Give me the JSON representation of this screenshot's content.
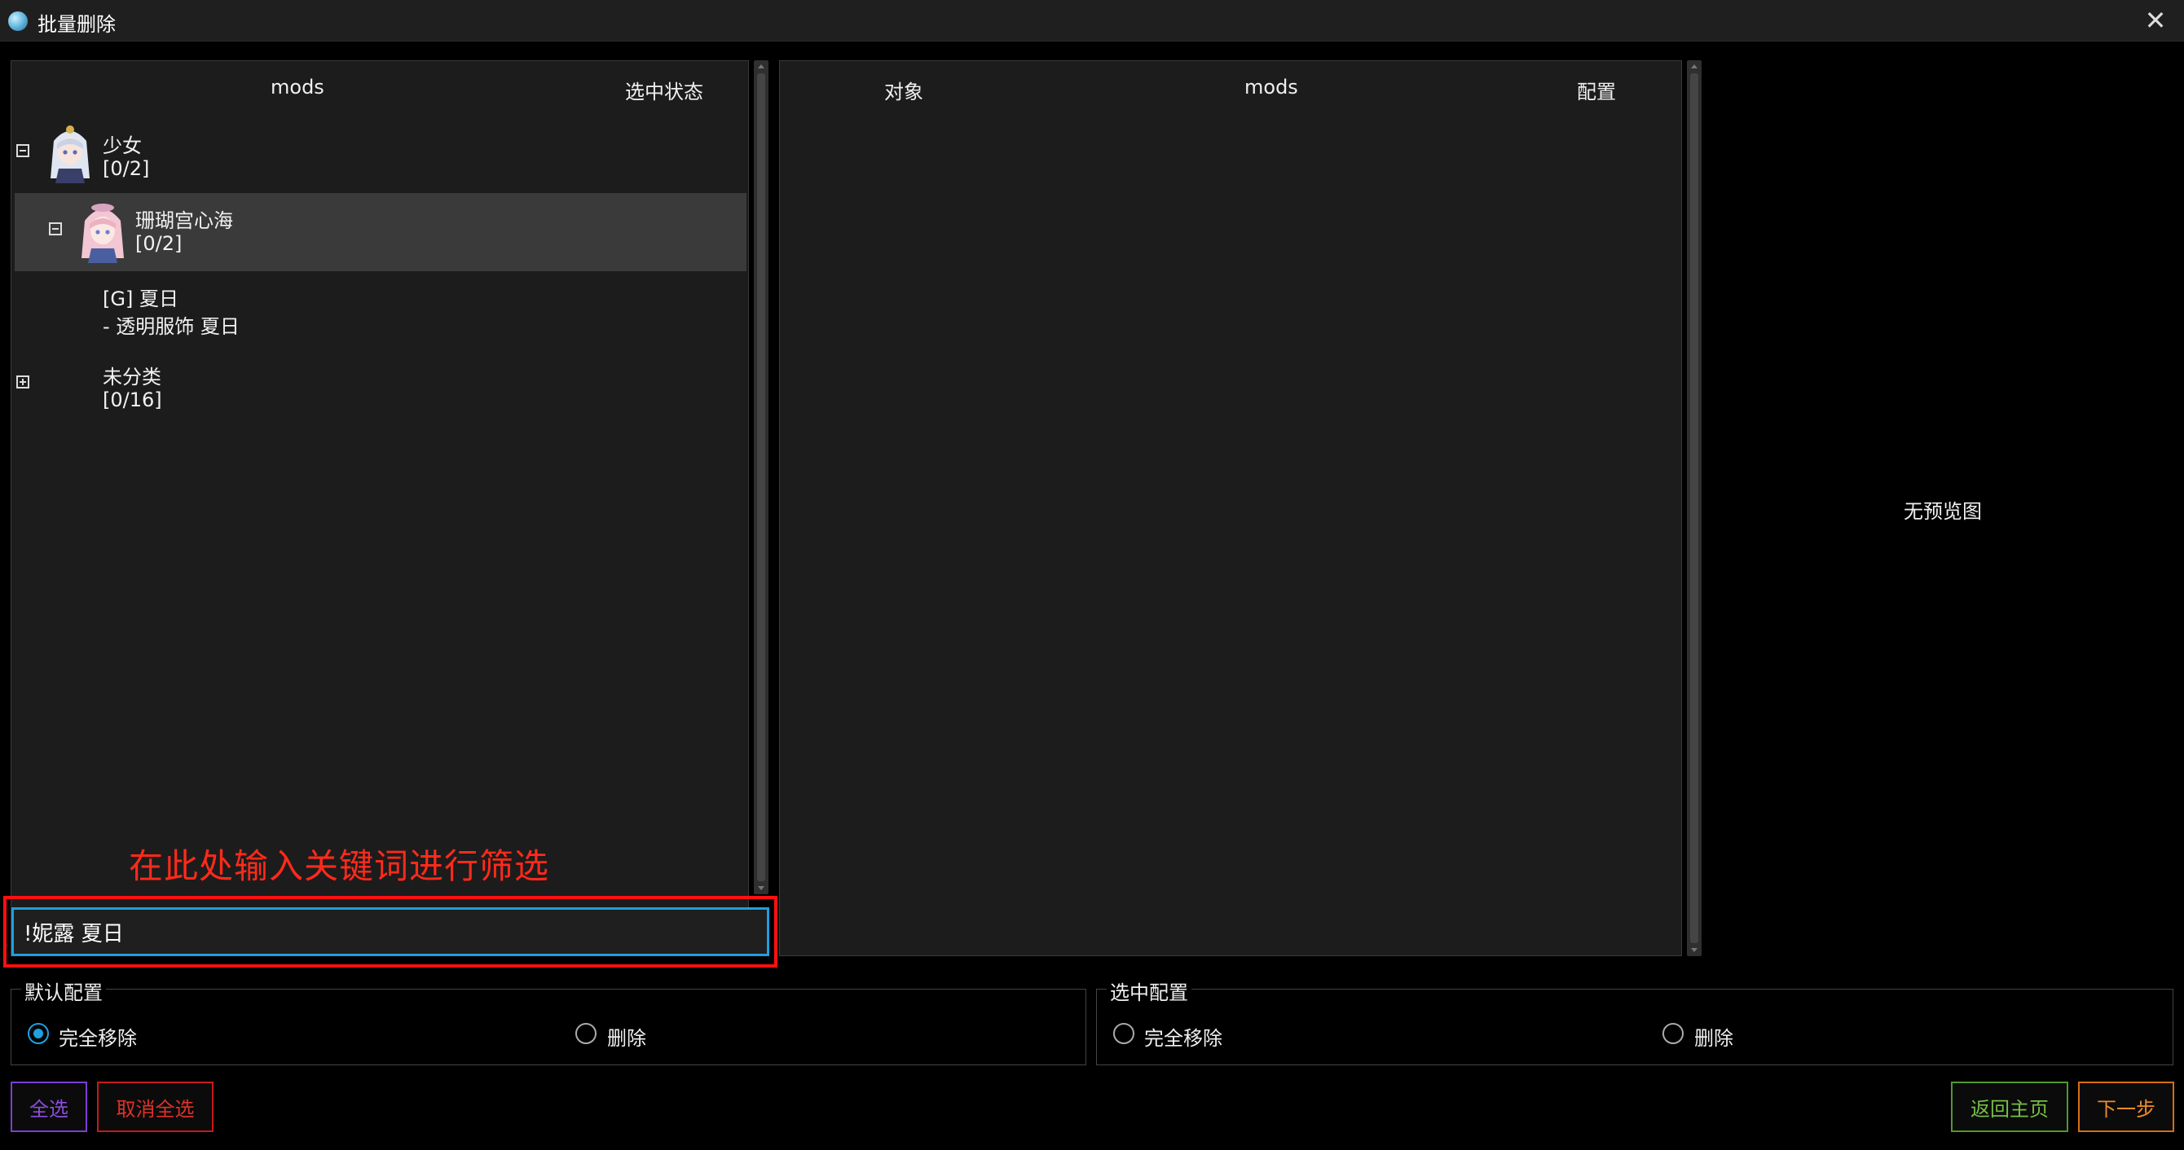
{
  "window": {
    "title": "批量删除"
  },
  "left_table": {
    "columns": [
      "mods",
      "选中状态"
    ],
    "rows": [
      {
        "name": "少女",
        "status": "[0/2]",
        "expander": "minus"
      },
      {
        "name": "珊瑚宫心海",
        "status": "[0/2]",
        "expander": "minus"
      },
      {
        "name": "[G] 夏日",
        "status": "- 透明服饰 夏日",
        "expander": ""
      },
      {
        "name": "未分类",
        "status": "[0/16]",
        "expander": "plus"
      }
    ]
  },
  "right_table": {
    "columns": [
      "对象",
      "mods",
      "配置"
    ]
  },
  "preview": {
    "empty_text": "无预览图"
  },
  "filter": {
    "annotation": "在此处输入关键词进行筛选",
    "value": "!妮露 夏日"
  },
  "default_config": {
    "legend": "默认配置",
    "options": [
      "完全移除",
      "删除"
    ],
    "selected": "完全移除"
  },
  "selected_config": {
    "legend": "选中配置",
    "options": [
      "完全移除",
      "删除"
    ],
    "selected": ""
  },
  "buttons": {
    "select_all": "全选",
    "deselect_all": "取消全选",
    "back_home": "返回主页",
    "next": "下一步"
  },
  "colors": {
    "accent": "#1e9fe0",
    "annotation_red": "#ff2a1a",
    "select_all": "#8b4ddd",
    "deselect_all": "#e0302a",
    "back_home": "#74c043",
    "next": "#f08a2a"
  },
  "icons": {
    "app": "app-logo-icon",
    "close": "close-icon",
    "expand": "tree-expand-icon",
    "collapse": "tree-collapse-icon"
  }
}
